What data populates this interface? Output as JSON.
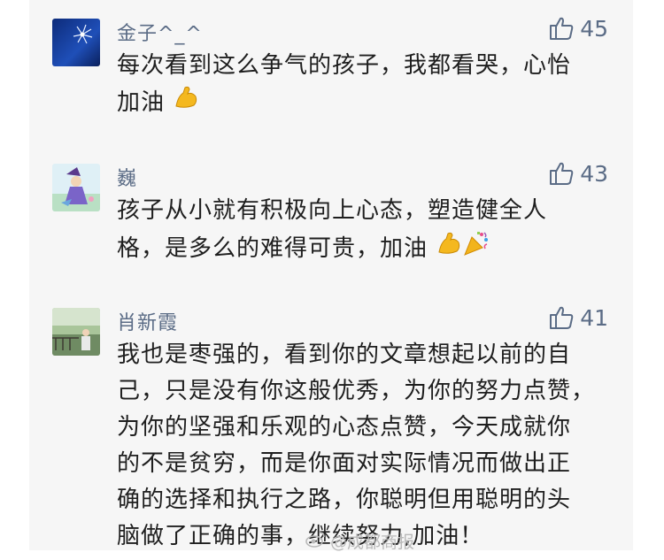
{
  "comments": [
    {
      "username": "金子^_^",
      "likes": "45",
      "lines": [
        "每次看到这么争气的孩子，我都看哭，心怡",
        "加油"
      ],
      "emojis": [
        "flexed-biceps"
      ]
    },
    {
      "username": "巍",
      "likes": "43",
      "lines": [
        "孩子从小就有积极向上心态，塑造健全人",
        "格，是多么的难得可贵，加油"
      ],
      "emojis": [
        "flexed-biceps",
        "party-popper"
      ]
    },
    {
      "username": "肖新霞",
      "likes": "41",
      "lines": [
        "我也是枣强的，看到你的文章想起以前的自",
        "己，只是没有你这般优秀，为你的努力点赞，",
        "为你的坚强和乐观的心态点赞，今天成就你",
        "的不是贫穷，而是你面对实际情况而做出正",
        "确的选择和执行之路，你聪明但用聪明的头",
        "脑做了正确的事，继续努力,加油！"
      ],
      "emojis": []
    }
  ],
  "watermark": {
    "text": "@成都商报",
    "icon": "weibo-logo-icon"
  },
  "colors": {
    "username": "#5b6c86",
    "text": "#1e1e1e",
    "panel": "#f6f6f6",
    "watermark": "#b9b9b9"
  }
}
